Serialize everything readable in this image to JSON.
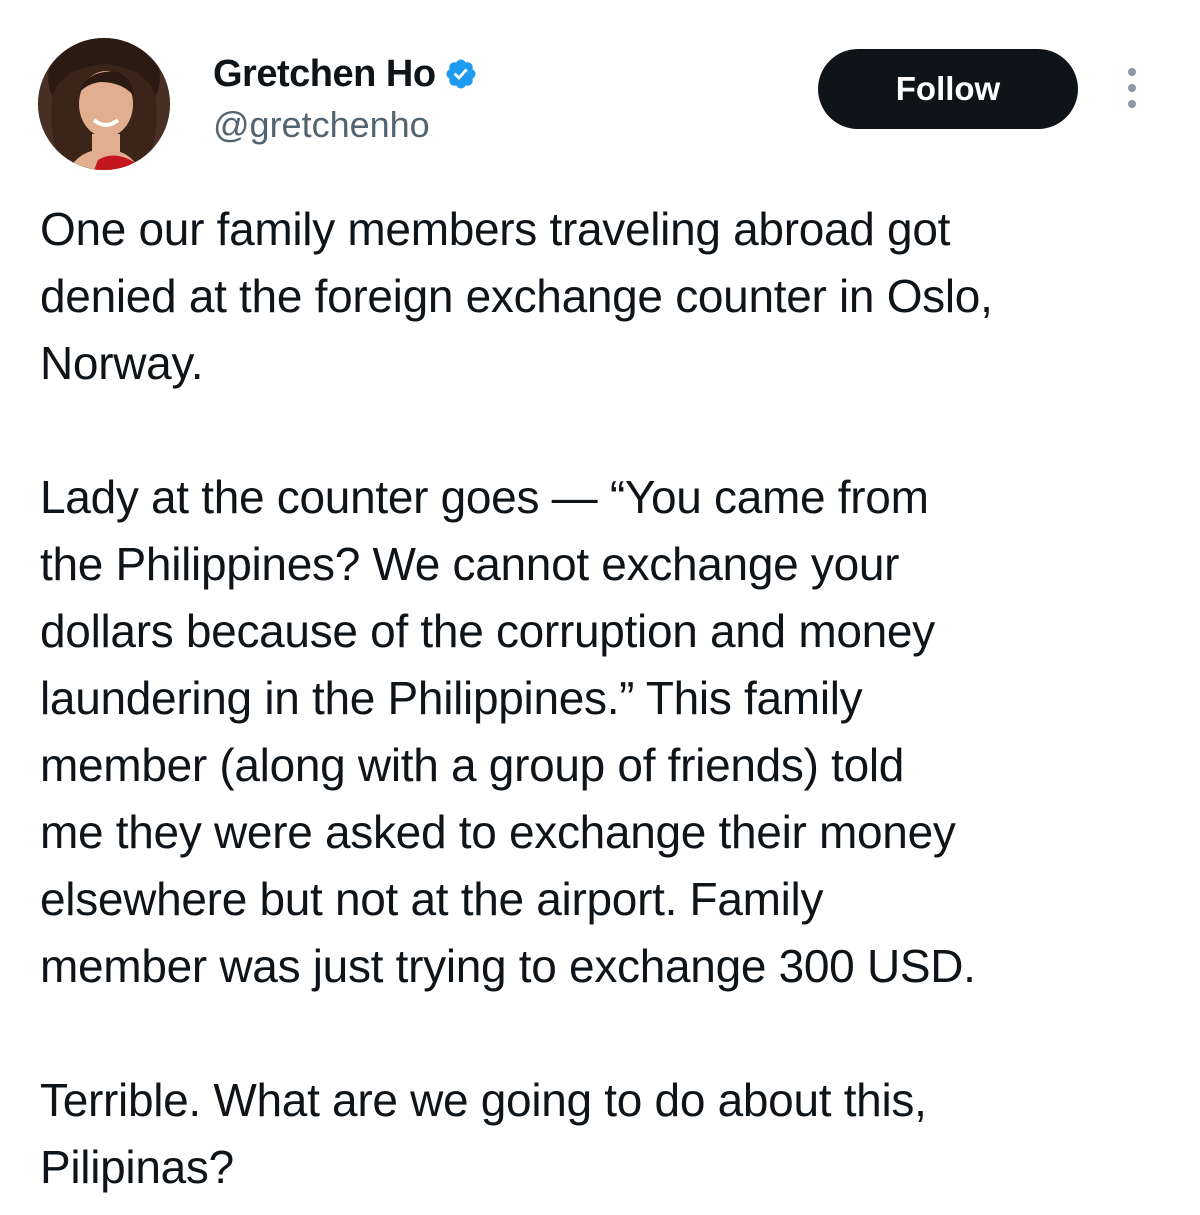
{
  "author": {
    "display_name": "Gretchen Ho",
    "handle": "@gretchenho",
    "verified": true,
    "avatar_icon": "profile-photo",
    "verified_color": "#1d9bf0"
  },
  "actions": {
    "follow_label": "Follow",
    "more_icon": "more-vertical-icon"
  },
  "tweet": {
    "paragraphs": [
      [
        "One our family members traveling abroad got",
        "denied at the foreign exchange counter in Oslo,",
        "Norway."
      ],
      [
        "Lady at the counter goes — “You came from",
        "the Philippines? We cannot exchange your",
        "dollars because of the corruption and money",
        "laundering in the Philippines.” This family",
        "member (along with a group of friends) told",
        "me they were asked to exchange their money",
        "elsewhere but not at the airport. Family",
        "member was just trying to exchange 300 USD."
      ],
      [
        "Terrible. What are we going to do about this,",
        "Pilipinas?"
      ]
    ]
  }
}
